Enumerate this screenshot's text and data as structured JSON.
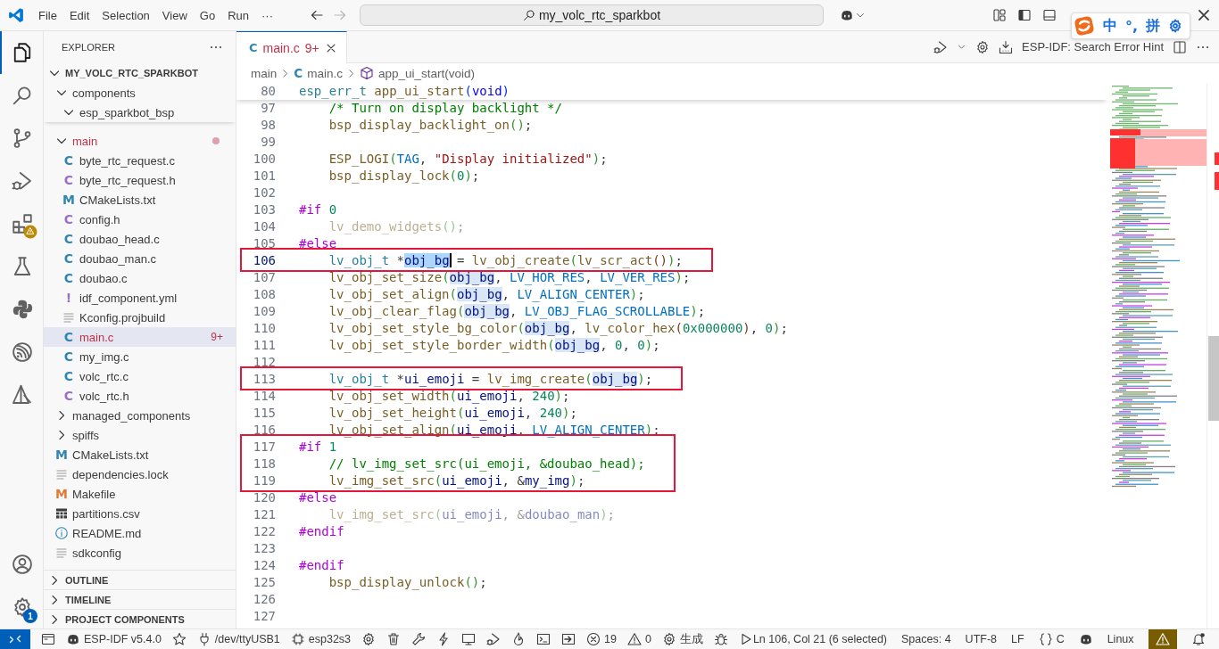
{
  "title_bar": {
    "menu": [
      "File",
      "Edit",
      "Selection",
      "View",
      "Go",
      "Run",
      "···"
    ],
    "search": "my_volc_rtc_sparkbot"
  },
  "ime_bar": {
    "items": [
      "中",
      "°,",
      "拼"
    ]
  },
  "activity_bar": {
    "items": [
      {
        "kind": "explorer",
        "selected": true,
        "alert": false
      },
      {
        "kind": "search",
        "selected": false,
        "alert": false
      },
      {
        "kind": "source-control",
        "selected": false,
        "alert": false
      },
      {
        "kind": "run-debug",
        "selected": false,
        "alert": false
      },
      {
        "kind": "extensions",
        "selected": false,
        "alert": true
      },
      {
        "kind": "testing",
        "selected": false,
        "alert": false
      },
      {
        "kind": "python",
        "selected": false,
        "alert": false
      },
      {
        "kind": "espressif",
        "selected": false,
        "alert": false
      },
      {
        "kind": "tool",
        "selected": false,
        "alert": false
      }
    ],
    "bottom": [
      {
        "kind": "account"
      },
      {
        "kind": "settings",
        "badge": "1"
      }
    ]
  },
  "sidebar": {
    "title": "EXPLORER",
    "root": {
      "label": "MY_VOLC_RTC_SPARKBOT",
      "kind": "root",
      "expanded": true,
      "selected": false,
      "error": false,
      "children": [
        {
          "label": "components",
          "kind": "folder",
          "expanded": true,
          "selected": false,
          "error": false,
          "children": [
            {
              "label": "esp_sparkbot_bsp",
              "kind": "folder",
              "expanded": true,
              "selected": false,
              "error": false
            }
          ]
        },
        {
          "label": "main",
          "kind": "folder",
          "expanded": true,
          "selected": false,
          "error": true,
          "dot": true,
          "children": [
            {
              "label": "byte_rtc_request.c",
              "kind": "c",
              "glyph": "C",
              "selected": false,
              "error": false
            },
            {
              "label": "byte_rtc_request.h",
              "kind": "h",
              "glyph": "C",
              "selected": false,
              "error": false
            },
            {
              "label": "CMakeLists.txt",
              "kind": "cmake",
              "glyph": "M",
              "selected": false,
              "error": false
            },
            {
              "label": "config.h",
              "kind": "h",
              "glyph": "C",
              "selected": false,
              "error": false
            },
            {
              "label": "doubao_head.c",
              "kind": "c",
              "glyph": "C",
              "selected": false,
              "error": false
            },
            {
              "label": "doubao_man.c",
              "kind": "c",
              "glyph": "C",
              "selected": false,
              "error": false
            },
            {
              "label": "doubao.c",
              "kind": "c",
              "glyph": "C",
              "selected": false,
              "error": false
            },
            {
              "label": "idf_component.yml",
              "kind": "yml",
              "glyph": "!",
              "selected": false,
              "error": false
            },
            {
              "label": "Kconfig.projbuild",
              "kind": "text",
              "selected": false,
              "error": false
            },
            {
              "label": "main.c",
              "kind": "c",
              "glyph": "C",
              "selected": true,
              "error": true,
              "badge": "9+"
            },
            {
              "label": "my_img.c",
              "kind": "c",
              "glyph": "C",
              "selected": false,
              "error": false
            },
            {
              "label": "volc_rtc.c",
              "kind": "c",
              "glyph": "C",
              "selected": false,
              "error": false
            },
            {
              "label": "volc_rtc.h",
              "kind": "h",
              "glyph": "C",
              "selected": false,
              "error": false
            }
          ]
        },
        {
          "label": "managed_components",
          "kind": "folder",
          "expanded": false,
          "selected": false,
          "error": false
        },
        {
          "label": "spiffs",
          "kind": "folder",
          "expanded": false,
          "selected": false,
          "error": false
        },
        {
          "label": "CMakeLists.txt",
          "kind": "cmake",
          "glyph": "M",
          "selected": false,
          "error": false
        },
        {
          "label": "dependencies.lock",
          "kind": "text",
          "selected": false,
          "error": false
        },
        {
          "label": "Makefile",
          "kind": "make",
          "glyph": "M",
          "selected": false,
          "error": false
        },
        {
          "label": "partitions.csv",
          "kind": "csv",
          "selected": false,
          "error": false
        },
        {
          "label": "README.md",
          "kind": "info",
          "selected": false,
          "error": false
        },
        {
          "label": "sdkconfig",
          "kind": "text",
          "selected": false,
          "error": false
        }
      ]
    },
    "sections": [
      {
        "label": "OUTLINE",
        "expanded": false
      },
      {
        "label": "TIMELINE",
        "expanded": false
      },
      {
        "label": "PROJECT COMPONENTS",
        "expanded": false
      }
    ]
  },
  "editor": {
    "tab": {
      "glyph": "C",
      "label": "main.c",
      "badge": "9+",
      "selected": true
    },
    "actions": [
      {
        "kind": "run-debug"
      },
      {
        "kind": "gear"
      },
      {
        "kind": "download"
      },
      {
        "kind": "text",
        "text": "ESP-IDF: Search Error Hint"
      },
      {
        "kind": "split"
      },
      {
        "kind": "more"
      }
    ],
    "breadcrumb": [
      {
        "kind": "folder",
        "label": "main"
      },
      {
        "kind": "c",
        "glyph": "C",
        "label": "main.c"
      },
      {
        "kind": "function",
        "label": "app_ui_start(void)"
      }
    ],
    "sticky_line": {
      "n": "80",
      "indented": false,
      "t": [
        {
          "text": "esp_err_t ",
          "kind": "type"
        },
        {
          "text": "app_ui_start",
          "kind": "function"
        },
        {
          "text": "(",
          "kind": "bracket1"
        },
        {
          "text": "void",
          "kind": "keyword"
        },
        {
          "text": ")",
          "kind": "bracket1"
        }
      ]
    },
    "lines": [
      {
        "n": "97",
        "current": false,
        "inactive": false,
        "indented": true,
        "t": [
          {
            "text": "/* Turn on display backlight */",
            "kind": "comment"
          }
        ]
      },
      {
        "n": "98",
        "current": false,
        "inactive": false,
        "indented": true,
        "t": [
          {
            "text": "bsp_display_backlight_on",
            "kind": "function"
          },
          {
            "text": "()",
            "kind": "bracket2"
          },
          {
            "text": ";",
            "kind": "plain"
          }
        ]
      },
      {
        "n": "99",
        "current": false
      },
      {
        "n": "100",
        "current": false,
        "inactive": false,
        "indented": true,
        "t": [
          {
            "text": "ESP_LOGI",
            "kind": "function"
          },
          {
            "text": "(",
            "kind": "bracket2"
          },
          {
            "text": "TAG",
            "kind": "constant"
          },
          {
            "text": ", ",
            "kind": "plain"
          },
          {
            "text": "\"Display initialized\"",
            "kind": "string"
          },
          {
            "text": ")",
            "kind": "bracket2"
          },
          {
            "text": ";",
            "kind": "plain"
          }
        ]
      },
      {
        "n": "101",
        "current": false,
        "inactive": false,
        "indented": true,
        "t": [
          {
            "text": "bsp_display_lock",
            "kind": "function"
          },
          {
            "text": "(",
            "kind": "bracket2"
          },
          {
            "text": "0",
            "kind": "number"
          },
          {
            "text": ")",
            "kind": "bracket2"
          },
          {
            "text": ";",
            "kind": "plain"
          }
        ]
      },
      {
        "n": "102",
        "current": false
      },
      {
        "n": "103",
        "current": false,
        "inactive": false,
        "indented": false,
        "t": [
          {
            "text": "#if ",
            "kind": "macro"
          },
          {
            "text": "0",
            "kind": "number"
          }
        ]
      },
      {
        "n": "104",
        "current": false,
        "inactive": true,
        "indented": true,
        "t": [
          {
            "text": "lv_demo_widgets",
            "kind": "function"
          },
          {
            "text": "()",
            "kind": "bracket2"
          },
          {
            "text": ";",
            "kind": "plain"
          }
        ]
      },
      {
        "n": "105",
        "current": false,
        "inactive": false,
        "indented": false,
        "t": [
          {
            "text": "#else",
            "kind": "macro"
          }
        ]
      },
      {
        "n": "106",
        "current": true,
        "inactive": false,
        "boxed": true,
        "indented": true,
        "t": [
          {
            "text": "lv_obj_t ",
            "kind": "type"
          },
          {
            "text": "*",
            "kind": "plain"
          },
          {
            "text": "obj_bg",
            "kind": "variable",
            "cursor": true
          },
          {
            "text": " = ",
            "kind": "plain"
          },
          {
            "text": "lv_obj_create",
            "kind": "function"
          },
          {
            "text": "(",
            "kind": "bracket2"
          },
          {
            "text": "lv_scr_act",
            "kind": "function"
          },
          {
            "text": "()",
            "kind": "bracket3"
          },
          {
            "text": ")",
            "kind": "bracket2"
          },
          {
            "text": ";",
            "kind": "plain"
          }
        ]
      },
      {
        "n": "107",
        "current": false,
        "inactive": false,
        "indented": true,
        "t": [
          {
            "text": "lv_obj_set_size",
            "kind": "function"
          },
          {
            "text": "(",
            "kind": "bracket2"
          },
          {
            "text": "obj_bg",
            "kind": "variable",
            "match": true
          },
          {
            "text": ", ",
            "kind": "plain"
          },
          {
            "text": "LV_HOR_RES",
            "kind": "constant"
          },
          {
            "text": ", ",
            "kind": "plain"
          },
          {
            "text": "LV_VER_RES",
            "kind": "constant"
          },
          {
            "text": ")",
            "kind": "bracket2"
          },
          {
            "text": ";",
            "kind": "plain"
          }
        ]
      },
      {
        "n": "108",
        "current": false,
        "inactive": false,
        "indented": true,
        "t": [
          {
            "text": "lv_obj_set_align",
            "kind": "function"
          },
          {
            "text": "(",
            "kind": "bracket2"
          },
          {
            "text": "obj_bg",
            "kind": "variable",
            "match": true
          },
          {
            "text": ", ",
            "kind": "plain"
          },
          {
            "text": "LV_ALIGN_CENTER",
            "kind": "constant"
          },
          {
            "text": ")",
            "kind": "bracket2"
          },
          {
            "text": ";",
            "kind": "plain"
          }
        ]
      },
      {
        "n": "109",
        "current": false,
        "inactive": false,
        "indented": true,
        "t": [
          {
            "text": "lv_obj_clear_flag",
            "kind": "function"
          },
          {
            "text": "(",
            "kind": "bracket2"
          },
          {
            "text": "obj_bg",
            "kind": "variable",
            "match": true
          },
          {
            "text": ", ",
            "kind": "plain"
          },
          {
            "text": "LV_OBJ_FLAG_SCROLLABLE",
            "kind": "constant"
          },
          {
            "text": ")",
            "kind": "bracket2"
          },
          {
            "text": ";",
            "kind": "plain"
          }
        ]
      },
      {
        "n": "110",
        "current": false,
        "inactive": false,
        "indented": true,
        "t": [
          {
            "text": "lv_obj_set_style_bg_color",
            "kind": "function"
          },
          {
            "text": "(",
            "kind": "bracket2"
          },
          {
            "text": "obj_bg",
            "kind": "variable",
            "match": true
          },
          {
            "text": ", ",
            "kind": "plain"
          },
          {
            "text": "lv_color_hex",
            "kind": "function"
          },
          {
            "text": "(",
            "kind": "bracket3"
          },
          {
            "text": "0x000000",
            "kind": "number"
          },
          {
            "text": ")",
            "kind": "bracket3"
          },
          {
            "text": ", ",
            "kind": "plain"
          },
          {
            "text": "0",
            "kind": "number"
          },
          {
            "text": ")",
            "kind": "bracket2"
          },
          {
            "text": ";",
            "kind": "plain"
          }
        ]
      },
      {
        "n": "111",
        "current": false,
        "inactive": false,
        "indented": true,
        "t": [
          {
            "text": "lv_obj_set_style_border_width",
            "kind": "function"
          },
          {
            "text": "(",
            "kind": "bracket2"
          },
          {
            "text": "obj_bg",
            "kind": "variable",
            "match": true
          },
          {
            "text": ", ",
            "kind": "plain"
          },
          {
            "text": "0",
            "kind": "number"
          },
          {
            "text": ", ",
            "kind": "plain"
          },
          {
            "text": "0",
            "kind": "number"
          },
          {
            "text": ")",
            "kind": "bracket2"
          },
          {
            "text": ";",
            "kind": "plain"
          }
        ]
      },
      {
        "n": "112",
        "current": false
      },
      {
        "n": "113",
        "current": false,
        "inactive": false,
        "boxed": true,
        "indented": true,
        "t": [
          {
            "text": "lv_obj_t ",
            "kind": "type"
          },
          {
            "text": "*",
            "kind": "plain"
          },
          {
            "text": "ui_emoji",
            "kind": "variable"
          },
          {
            "text": " = ",
            "kind": "plain"
          },
          {
            "text": "lv_img_create",
            "kind": "function"
          },
          {
            "text": "(",
            "kind": "bracket2"
          },
          {
            "text": "obj_bg",
            "kind": "variable",
            "match": true
          },
          {
            "text": ")",
            "kind": "bracket2"
          },
          {
            "text": ";",
            "kind": "plain"
          }
        ]
      },
      {
        "n": "114",
        "current": false,
        "inactive": false,
        "indented": true,
        "t": [
          {
            "text": "lv_obj_set_width",
            "kind": "function"
          },
          {
            "text": "(",
            "kind": "bracket2"
          },
          {
            "text": "ui_emoji",
            "kind": "variable"
          },
          {
            "text": ", ",
            "kind": "plain"
          },
          {
            "text": "240",
            "kind": "number"
          },
          {
            "text": ")",
            "kind": "bracket2"
          },
          {
            "text": ";",
            "kind": "plain"
          }
        ]
      },
      {
        "n": "115",
        "current": false,
        "inactive": false,
        "indented": true,
        "t": [
          {
            "text": "lv_obj_set_height",
            "kind": "function"
          },
          {
            "text": "(",
            "kind": "bracket2"
          },
          {
            "text": "ui_emoji",
            "kind": "variable"
          },
          {
            "text": ", ",
            "kind": "plain"
          },
          {
            "text": "240",
            "kind": "number"
          },
          {
            "text": ")",
            "kind": "bracket2"
          },
          {
            "text": ";",
            "kind": "plain"
          }
        ]
      },
      {
        "n": "116",
        "current": false,
        "inactive": false,
        "indented": true,
        "t": [
          {
            "text": "lv_obj_set_align",
            "kind": "function"
          },
          {
            "text": "(",
            "kind": "bracket2"
          },
          {
            "text": "ui_emoji",
            "kind": "variable"
          },
          {
            "text": ", ",
            "kind": "plain"
          },
          {
            "text": "LV_ALIGN_CENTER",
            "kind": "constant"
          },
          {
            "text": ")",
            "kind": "bracket2"
          },
          {
            "text": ";",
            "kind": "plain"
          }
        ]
      },
      {
        "n": "117",
        "current": false,
        "inactive": false,
        "boxed": true,
        "indented": false,
        "t": [
          {
            "text": "#if ",
            "kind": "macro"
          },
          {
            "text": "1",
            "kind": "number"
          }
        ]
      },
      {
        "n": "118",
        "current": false,
        "inactive": false,
        "boxed": true,
        "indented": true,
        "t": [
          {
            "text": "// lv_img_set_src(ui_emoji, &doubao_head);",
            "kind": "comment"
          }
        ]
      },
      {
        "n": "119",
        "current": false,
        "inactive": false,
        "boxed": true,
        "indented": true,
        "t": [
          {
            "text": "lv_img_set_src",
            "kind": "function"
          },
          {
            "text": "(",
            "kind": "bracket2"
          },
          {
            "text": "ui_emoji",
            "kind": "variable"
          },
          {
            "text": ", &",
            "kind": "plain"
          },
          {
            "text": "my_img",
            "kind": "variable"
          },
          {
            "text": ")",
            "kind": "bracket2"
          },
          {
            "text": ";",
            "kind": "plain"
          }
        ]
      },
      {
        "n": "120",
        "current": false,
        "inactive": false,
        "indented": false,
        "t": [
          {
            "text": "#else",
            "kind": "macro"
          }
        ]
      },
      {
        "n": "121",
        "current": false,
        "inactive": true,
        "indented": true,
        "t": [
          {
            "text": "lv_img_set_src",
            "kind": "function"
          },
          {
            "text": "(",
            "kind": "bracket2"
          },
          {
            "text": "ui_emoji",
            "kind": "variable"
          },
          {
            "text": ", &",
            "kind": "plain"
          },
          {
            "text": "doubao_man",
            "kind": "variable"
          },
          {
            "text": ")",
            "kind": "bracket2"
          },
          {
            "text": ";",
            "kind": "plain"
          }
        ]
      },
      {
        "n": "122",
        "current": false,
        "inactive": false,
        "indented": false,
        "t": [
          {
            "text": "#endif",
            "kind": "macro"
          }
        ]
      },
      {
        "n": "123",
        "current": false
      },
      {
        "n": "124",
        "current": false,
        "inactive": false,
        "indented": false,
        "t": [
          {
            "text": "#endif",
            "kind": "macro"
          }
        ]
      },
      {
        "n": "125",
        "current": false,
        "inactive": false,
        "indented": true,
        "t": [
          {
            "text": "bsp_display_unlock",
            "kind": "function"
          },
          {
            "text": "()",
            "kind": "bracket2"
          },
          {
            "text": ";",
            "kind": "plain"
          }
        ]
      },
      {
        "n": "126",
        "current": false
      },
      {
        "n": "127",
        "current": false
      }
    ]
  },
  "status_bar": {
    "left": [
      {
        "kind": "remote"
      },
      {
        "kind": "folder"
      },
      {
        "kind": "robot",
        "text": "ESP-IDF v5.4.0"
      },
      {
        "kind": "star"
      },
      {
        "kind": "plug",
        "text": "/dev/ttyUSB1"
      },
      {
        "kind": "chip",
        "text": "esp32s3"
      },
      {
        "kind": "gear"
      },
      {
        "kind": "trash"
      },
      {
        "kind": "wrench"
      },
      {
        "kind": "bolt"
      },
      {
        "kind": "monitor"
      },
      {
        "kind": "run-debug"
      },
      {
        "kind": "flame"
      },
      {
        "kind": "terminal"
      },
      {
        "kind": "enter"
      },
      {
        "kind": "error",
        "text": "19"
      },
      {
        "kind": "warning",
        "text": "0"
      },
      {
        "kind": "gear",
        "text": "生成"
      },
      {
        "kind": "bug"
      },
      {
        "kind": "play"
      }
    ],
    "right": [
      {
        "kind": "text",
        "text": "Ln 106, Col 21 (6 selected)"
      },
      {
        "kind": "text",
        "text": "Spaces: 4"
      },
      {
        "kind": "text",
        "text": "UTF-8"
      },
      {
        "kind": "text",
        "text": "LF"
      },
      {
        "kind": "braces",
        "text": "C"
      },
      {
        "kind": "robot"
      },
      {
        "kind": "text",
        "text": "Linux"
      },
      {
        "kind": "alert"
      },
      {
        "kind": "bell"
      }
    ]
  }
}
